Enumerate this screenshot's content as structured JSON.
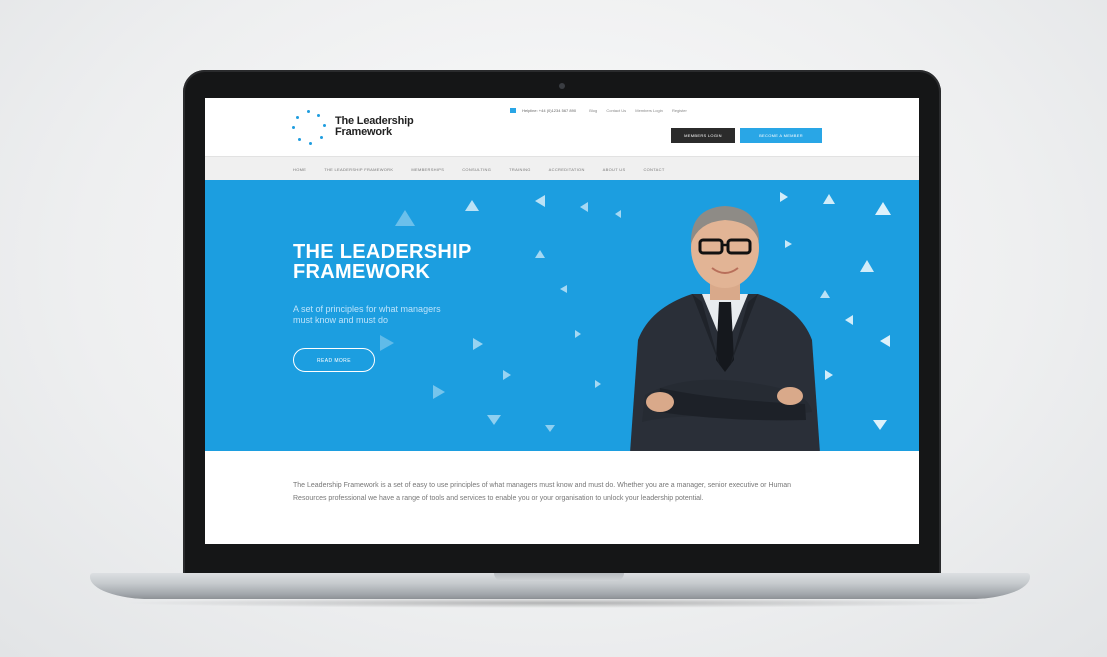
{
  "site": {
    "logo_line1": "The Leadership",
    "logo_line2": "Framework",
    "topbar": {
      "phone": "Helpline: +44 (0)1234 567 890",
      "links": [
        "Blog",
        "Contact Us",
        "Members Login",
        "Register"
      ]
    },
    "members_login_label": "MEMBERS LOGIN",
    "become_member_label": "BECOME A MEMBER",
    "nav": [
      "HOME",
      "THE LEADERSHIP FRAMEWORK",
      "MEMBERSHIPS",
      "CONSULTING",
      "TRAINING",
      "ACCREDITATION",
      "ABOUT US",
      "CONTACT"
    ],
    "hero": {
      "title_line1": "THE LEADERSHIP",
      "title_line2": "FRAMEWORK",
      "subtitle": "A set of principles for what managers must know and must do",
      "button_label": "READ MORE"
    },
    "intro": "The Leadership Framework is a set of easy to use principles of what managers must know and must do. Whether you are a manager, senior executive or Human Resources professional we have a range of tools and services to enable you or your organisation to unlock your leadership potential."
  },
  "colors": {
    "accent": "#1c9ee0",
    "dark_button": "#2b2b2b"
  }
}
